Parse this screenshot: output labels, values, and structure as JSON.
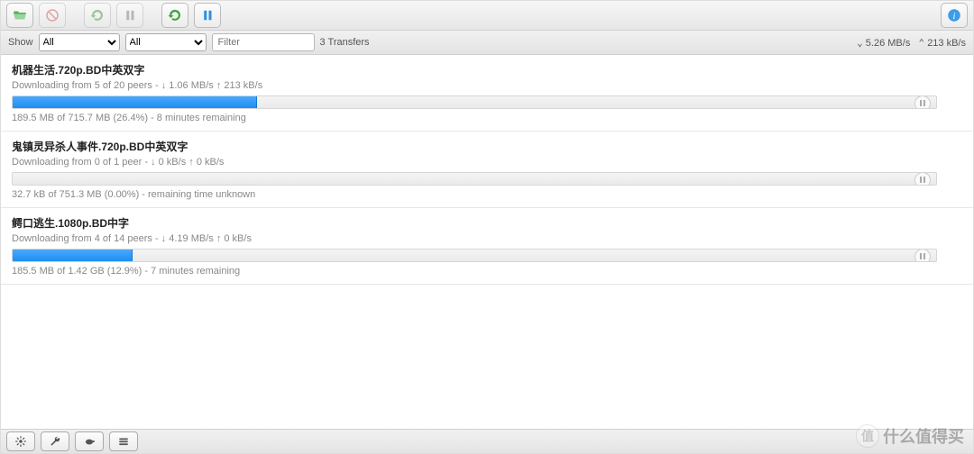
{
  "filterbar": {
    "show_label": "Show",
    "select1": "All",
    "select2": "All",
    "filter_placeholder": "Filter",
    "count_text": "3 Transfers",
    "down_rate": "5.26 MB/s",
    "up_rate": "213 kB/s"
  },
  "transfers": [
    {
      "title": "机器生活.720p.BD中英双字",
      "status": "Downloading from 5 of 20 peers - ↓ 1.06 MB/s ↑ 213 kB/s",
      "progress_percent": 26.4,
      "stalled": false,
      "post": "189.5 MB of 715.7 MB (26.4%) - 8 minutes remaining"
    },
    {
      "title": "鬼镇灵异杀人事件.720p.BD中英双字",
      "status": "Downloading from 0 of 1 peer - ↓ 0 kB/s ↑ 0 kB/s",
      "progress_percent": 0.0,
      "stalled": true,
      "post": "32.7 kB of 751.3 MB (0.00%) - remaining time unknown"
    },
    {
      "title": "鳄口逃生.1080p.BD中字",
      "status": "Downloading from 4 of 14 peers - ↓ 4.19 MB/s ↑ 0 kB/s",
      "progress_percent": 12.9,
      "stalled": false,
      "post": "185.5 MB of 1.42 GB (12.9%) - 7 minutes remaining"
    }
  ],
  "icons": {
    "open": "open-icon",
    "remove": "remove-icon",
    "resume": "resume-icon",
    "pause": "pause-icon",
    "resume_all": "resume-all-icon",
    "pause_all": "pause-all-icon",
    "info": "info-icon",
    "settings": "gear-icon",
    "prefs": "wrench-icon",
    "turtle": "turtle-icon",
    "compact": "compact-icon"
  },
  "watermark": {
    "badge": "值",
    "text": "什么值得买"
  }
}
